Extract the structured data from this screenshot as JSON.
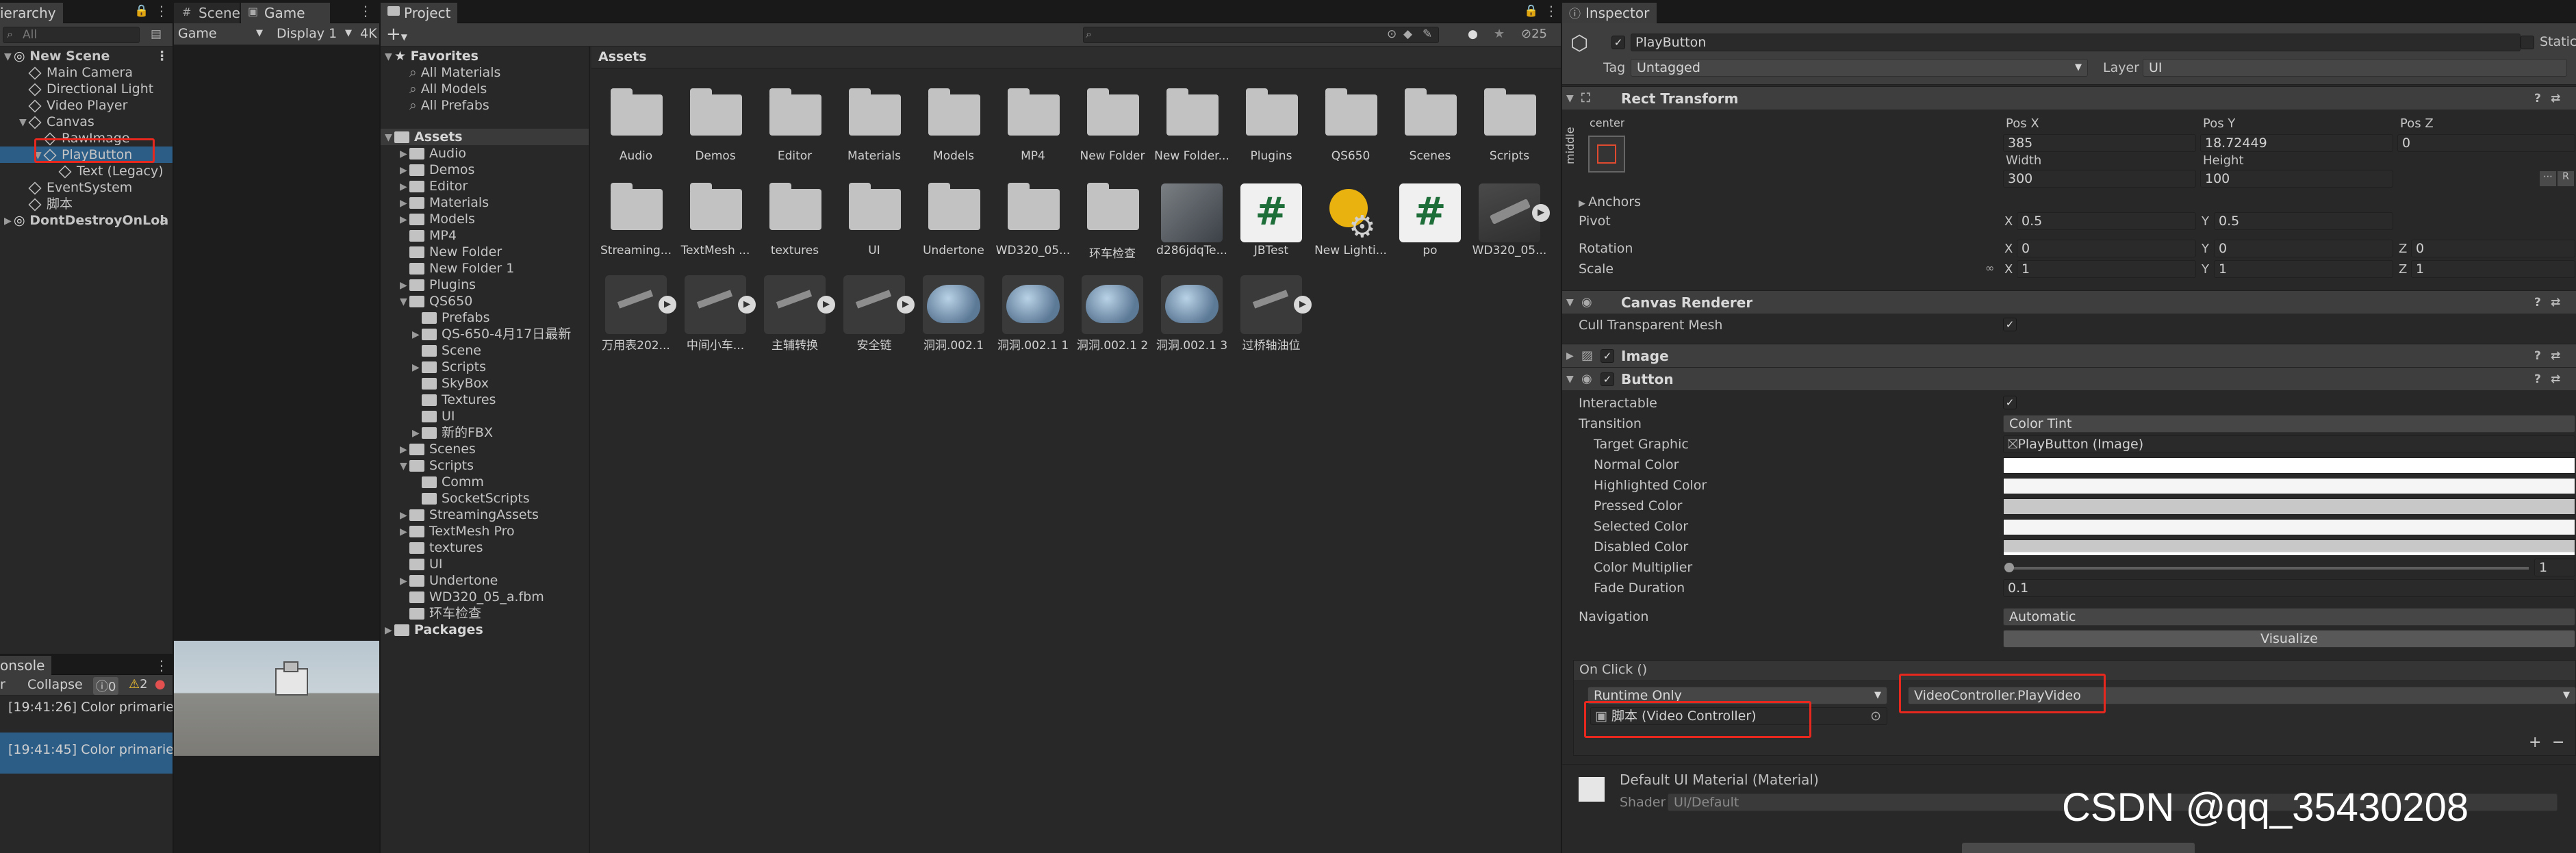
{
  "hierarchy": {
    "tab": "ierarchy",
    "search_placeholder": "All",
    "rows": [
      {
        "label": "New Scene",
        "indent": 0,
        "kind": "scene"
      },
      {
        "label": "Main Camera",
        "indent": 1,
        "kind": "go"
      },
      {
        "label": "Directional Light",
        "indent": 1,
        "kind": "go"
      },
      {
        "label": "Video Player",
        "indent": 1,
        "kind": "go"
      },
      {
        "label": "Canvas",
        "indent": 1,
        "kind": "go"
      },
      {
        "label": "RawImage",
        "indent": 2,
        "kind": "go"
      },
      {
        "label": "PlayButton",
        "indent": 2,
        "kind": "go",
        "selected": true
      },
      {
        "label": "Text (Legacy)",
        "indent": 3,
        "kind": "go"
      },
      {
        "label": "EventSystem",
        "indent": 1,
        "kind": "go"
      },
      {
        "label": "脚本",
        "indent": 1,
        "kind": "go"
      },
      {
        "label": "DontDestroyOnLoa",
        "indent": 0,
        "kind": "scene"
      }
    ]
  },
  "scene_game": {
    "tab_scene": "Scene",
    "tab_game": "Game",
    "game_dropdown": "Game",
    "display_dropdown": "Display 1",
    "res_label": "4K"
  },
  "console": {
    "tab": "onsole",
    "clear": "r",
    "collapse": "Collapse",
    "count_info": "0",
    "count_warn": "2",
    "lines": [
      "[19:41:26] Color primaries",
      "[19:41:45] Color primaries"
    ]
  },
  "project": {
    "tab": "Project",
    "add_label": "+",
    "count_label": "25",
    "favorites_title": "Favorites",
    "favorites": [
      "All Materials",
      "All Models",
      "All Prefabs"
    ],
    "assets_root": "Assets",
    "tree": [
      {
        "label": "Audio",
        "indent": 1
      },
      {
        "label": "Demos",
        "indent": 1
      },
      {
        "label": "Editor",
        "indent": 1
      },
      {
        "label": "Materials",
        "indent": 1
      },
      {
        "label": "Models",
        "indent": 1
      },
      {
        "label": "MP4",
        "indent": 1
      },
      {
        "label": "New Folder",
        "indent": 1
      },
      {
        "label": "New Folder 1",
        "indent": 1
      },
      {
        "label": "Plugins",
        "indent": 1
      },
      {
        "label": "QS650",
        "indent": 1
      },
      {
        "label": "Prefabs",
        "indent": 2
      },
      {
        "label": "QS-650-4月17日最新",
        "indent": 2
      },
      {
        "label": "Scene",
        "indent": 2
      },
      {
        "label": "Scripts",
        "indent": 2
      },
      {
        "label": "SkyBox",
        "indent": 2
      },
      {
        "label": "Textures",
        "indent": 2
      },
      {
        "label": "UI",
        "indent": 2
      },
      {
        "label": "新的FBX",
        "indent": 2
      },
      {
        "label": "Scenes",
        "indent": 1
      },
      {
        "label": "Scripts",
        "indent": 1
      },
      {
        "label": "Comm",
        "indent": 2
      },
      {
        "label": "SocketScripts",
        "indent": 2
      },
      {
        "label": "StreamingAssets",
        "indent": 1
      },
      {
        "label": "TextMesh Pro",
        "indent": 1
      },
      {
        "label": "textures",
        "indent": 1
      },
      {
        "label": "UI",
        "indent": 1
      },
      {
        "label": "Undertone",
        "indent": 1
      },
      {
        "label": "WD320_05_a.fbm",
        "indent": 1
      },
      {
        "label": "环车检查",
        "indent": 1
      }
    ],
    "packages_root": "Packages",
    "breadcrumb": "Assets",
    "grid_row1": [
      "Audio",
      "Demos",
      "Editor",
      "Materials",
      "Models",
      "MP4",
      "New Folder",
      "New Folder...",
      "Plugins",
      "QS650",
      "Scenes",
      "Scripts"
    ],
    "grid_row2": [
      {
        "label": "Streaming...",
        "type": "folder"
      },
      {
        "label": "TextMesh ...",
        "type": "folder"
      },
      {
        "label": "textures",
        "type": "folder"
      },
      {
        "label": "UI",
        "type": "folder"
      },
      {
        "label": "Undertone",
        "type": "folder"
      },
      {
        "label": "WD320_05...",
        "type": "folder"
      },
      {
        "label": "环车检查",
        "type": "folder"
      },
      {
        "label": "d286jdqTe...",
        "type": "image"
      },
      {
        "label": "JBTest",
        "type": "script"
      },
      {
        "label": "New Lighti...",
        "type": "lighting"
      },
      {
        "label": "po",
        "type": "script"
      },
      {
        "label": "WD320_05...",
        "type": "model"
      }
    ],
    "grid_row3": [
      "万用表202...",
      "中间小车...",
      "主辅转换",
      "安全链",
      "洞洞.002.1",
      "洞洞.002.1 1",
      "洞洞.002.1 2",
      "洞洞.002.1 3",
      "过桥轴油位"
    ]
  },
  "inspector": {
    "tab": "Inspector",
    "object_name": "PlayButton",
    "static_label": "Static",
    "tag_label": "Tag",
    "tag_value": "Untagged",
    "layer_label": "Layer",
    "layer_value": "UI",
    "rect_transform": {
      "title": "Rect Transform",
      "anchor_preset_top": "center",
      "anchor_preset_side": "middle",
      "pos_x_label": "Pos X",
      "pos_x": "385",
      "pos_y_label": "Pos Y",
      "pos_y": "18.72449",
      "pos_z_label": "Pos Z",
      "pos_z": "0",
      "width_label": "Width",
      "width": "300",
      "height_label": "Height",
      "height": "100",
      "anchors_label": "Anchors",
      "pivot_label": "Pivot",
      "pivot_x": "0.5",
      "pivot_y": "0.5",
      "rotation_label": "Rotation",
      "rot_x": "0",
      "rot_y": "0",
      "rot_z": "0",
      "scale_label": "Scale",
      "scale_x": "1",
      "scale_y": "1",
      "scale_z": "1",
      "axis_x": "X",
      "axis_y": "Y",
      "axis_z": "Z"
    },
    "canvas_renderer": {
      "title": "Canvas Renderer",
      "cull_label": "Cull Transparent Mesh"
    },
    "image": {
      "title": "Image"
    },
    "button": {
      "title": "Button",
      "interactable_label": "Interactable",
      "transition_label": "Transition",
      "transition_value": "Color Tint",
      "target_graphic_label": "Target Graphic",
      "target_graphic_value": "PlayButton (Image)",
      "normal_color_label": "Normal Color",
      "highlighted_color_label": "Highlighted Color",
      "pressed_color_label": "Pressed Color",
      "selected_color_label": "Selected Color",
      "disabled_color_label": "Disabled Color",
      "color_multiplier_label": "Color Multiplier",
      "color_multiplier_value": "1",
      "fade_duration_label": "Fade Duration",
      "fade_duration_value": "0.1",
      "navigation_label": "Navigation",
      "navigation_value": "Automatic",
      "visualize_label": "Visualize",
      "on_click_label": "On Click ()",
      "runtime_value": "Runtime Only",
      "function_value": "VideoController.PlayVideo",
      "target_object_value": "脚本 (Video Controller)",
      "plus": "+",
      "minus": "−"
    },
    "material": {
      "name": "Default UI Material (Material)",
      "shader_label": "Shader",
      "shader_value": "UI/Default"
    },
    "watermark": "CSDN @qq_35430208"
  },
  "colors": {
    "selected_row": "#2c5d87",
    "highlight_box": "#e6281e",
    "panel_bg": "#282828",
    "header_bg": "#3e3e3e"
  }
}
